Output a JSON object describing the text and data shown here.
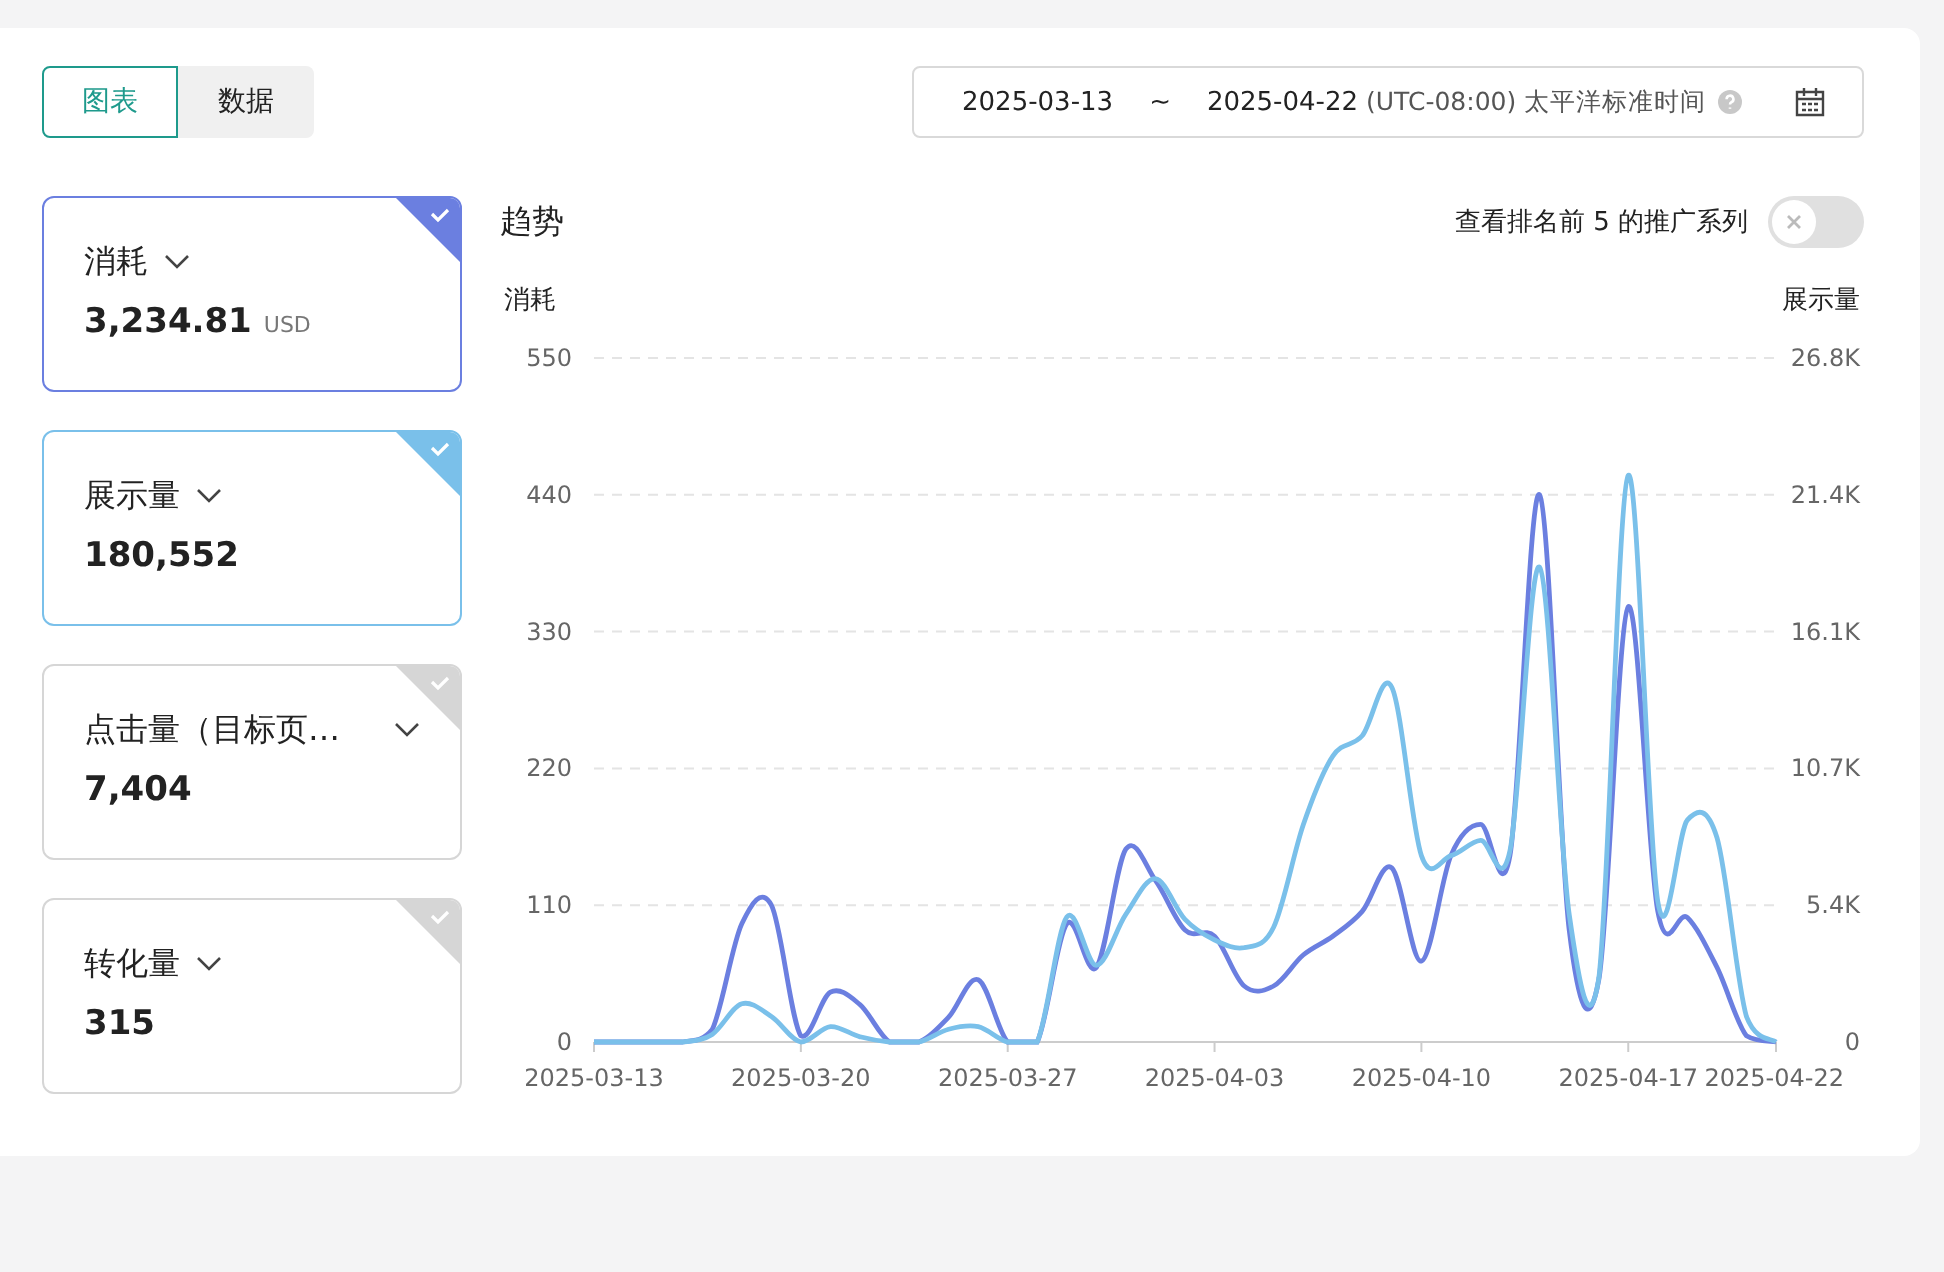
{
  "view_tabs": [
    {
      "label": "图表",
      "selected": true
    },
    {
      "label": "数据",
      "selected": false
    }
  ],
  "date_range": {
    "start": "2025-03-13",
    "separator": "~",
    "end": "2025-04-22",
    "timezone": "(UTC-08:00) 太平洋标准时间"
  },
  "metric_cards": [
    {
      "label": "消耗",
      "value": "3,234.81",
      "unit": "USD",
      "selected": true,
      "color": "#6b7fe0"
    },
    {
      "label": "展示量",
      "value": "180,552",
      "selected": true,
      "color": "#7ac0ea"
    },
    {
      "label": "点击量（目标页…",
      "value": "7,404",
      "selected": false
    },
    {
      "label": "转化量",
      "value": "315",
      "selected": false
    }
  ],
  "trend": {
    "title": "趋势",
    "toggle": {
      "label": "查看排名前 5 的推广系列",
      "on": false
    },
    "chart_data": {
      "type": "line",
      "ylabel": "消耗",
      "y2label": "展示量",
      "grid": true,
      "categories": [
        "2025-03-13",
        null,
        null,
        null,
        null,
        null,
        null,
        "2025-03-20",
        null,
        null,
        null,
        null,
        null,
        null,
        "2025-03-27",
        null,
        null,
        null,
        null,
        null,
        null,
        "2025-04-03",
        null,
        null,
        null,
        null,
        null,
        null,
        "2025-04-10",
        null,
        null,
        null,
        null,
        null,
        null,
        "2025-04-17",
        null,
        null,
        null,
        null,
        "2025-04-22"
      ],
      "ylim": [
        0,
        550
      ],
      "yticks": [
        0,
        110,
        220,
        330,
        440,
        550
      ],
      "y2lim": [
        0,
        26800
      ],
      "y2ticks": [
        {
          "value": 0,
          "label": "0"
        },
        {
          "value": 5360,
          "label": "5.4K"
        },
        {
          "value": 10720,
          "label": "10.7K"
        },
        {
          "value": 16080,
          "label": "16.1K"
        },
        {
          "value": 21440,
          "label": "21.4K"
        },
        {
          "value": 26800,
          "label": "26.8K"
        }
      ],
      "series": [
        {
          "color": "#6b7fe0",
          "values": [
            0,
            0,
            0,
            0,
            10,
            95,
            110,
            5,
            40,
            30,
            0,
            0,
            20,
            50,
            0,
            0,
            95,
            60,
            155,
            130,
            90,
            85,
            45,
            45,
            70,
            85,
            105,
            140,
            65,
            150,
            175,
            150,
            440,
            90,
            50,
            350,
            105,
            100,
            60,
            5,
            0
          ]
        },
        {
          "color": "#7ac0ea",
          "axis": "y2",
          "values": [
            0,
            0,
            0,
            0,
            300,
            1500,
            1000,
            0,
            600,
            200,
            0,
            0,
            500,
            600,
            0,
            0,
            4900,
            3000,
            5000,
            6400,
            4800,
            4000,
            3700,
            4500,
            8500,
            11200,
            12000,
            13900,
            7300,
            7300,
            7900,
            7500,
            18600,
            5000,
            2500,
            22200,
            5500,
            8700,
            8000,
            1000,
            0
          ]
        }
      ]
    }
  }
}
